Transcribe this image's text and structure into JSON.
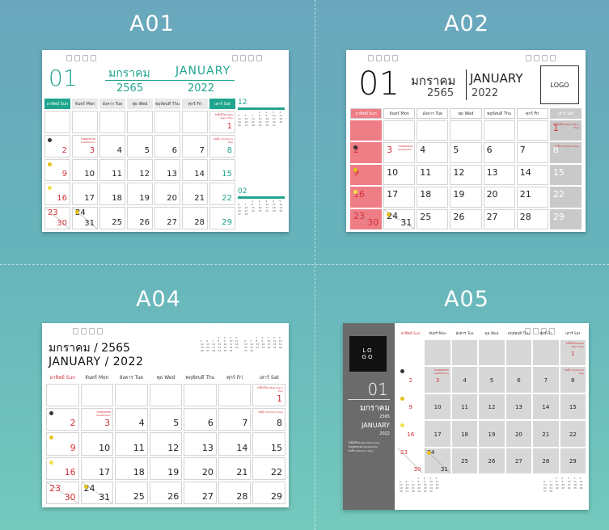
{
  "labels": {
    "a01": "A01",
    "a02": "A02",
    "a04": "A04",
    "a05": "A05"
  },
  "month_no": "01",
  "month_th": "มกราคม",
  "month_en": "JANUARY",
  "year_th": "2565",
  "year_en": "2022",
  "a04_line1": "มกราคม / 2565",
  "a04_line2": "JANUARY / 2022",
  "logo": "LOGO",
  "logo_split": [
    "LO",
    "GO"
  ],
  "weekdays": [
    "อาทิตย์ Sun",
    "จันทร์ Mon",
    "อังคาร Tue",
    "พุธ Wed",
    "พฤหัสบดี Thu",
    "ศุกร์ Fri",
    "เสาร์ Sat"
  ],
  "a01_next_month": "02",
  "a01_prev_month": "12",
  "a05_jan_full": "JANUARY",
  "rows": [
    [
      "",
      "",
      "",
      "",
      "",
      "",
      "1"
    ],
    [
      "2",
      "3",
      "4",
      "5",
      "6",
      "7",
      "8"
    ],
    [
      "9",
      "10",
      "11",
      "12",
      "13",
      "14",
      "15"
    ],
    [
      "16",
      "17",
      "18",
      "19",
      "20",
      "21",
      "22"
    ],
    [
      "23/30",
      "24/31",
      "25",
      "26",
      "27",
      "28",
      "29"
    ]
  ],
  "holiday_notes": {
    "new_year": "วันขึ้นปีใหม่ New Year's Day",
    "sub": "วันหยุดชดเชย Substitution",
    "child": "วันเด็ก Children's Day"
  },
  "colors": {
    "green": "#1fa58d",
    "pink": "#ef7d86",
    "gray": "#c9c9c9",
    "red": "#d2323a",
    "dark": "#6b6b6b"
  }
}
